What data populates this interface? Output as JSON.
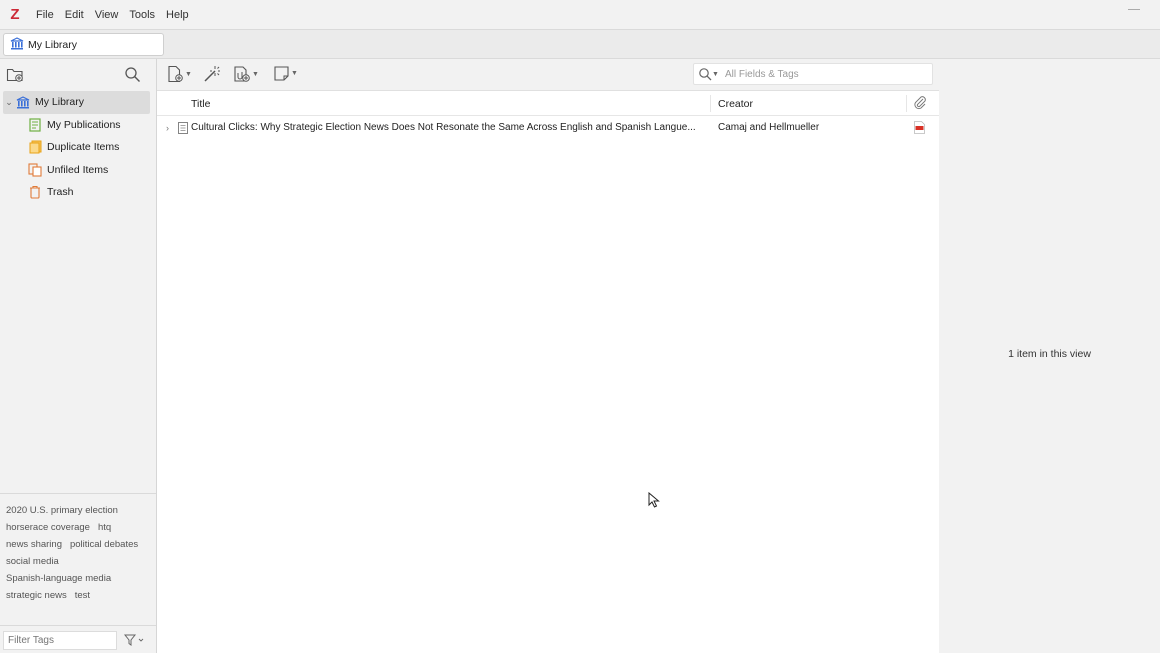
{
  "menubar": {
    "logo": "Z",
    "items": [
      "File",
      "Edit",
      "View",
      "Tools",
      "Help"
    ]
  },
  "tabs": [
    {
      "label": "My Library"
    }
  ],
  "collections": {
    "root": {
      "label": "My Library",
      "icon": "library-icon",
      "expanded": true
    },
    "children": [
      {
        "label": "My Publications",
        "icon": "publications-icon"
      },
      {
        "label": "Duplicate Items",
        "icon": "duplicate-icon"
      },
      {
        "label": "Unfiled Items",
        "icon": "unfiled-icon"
      },
      {
        "label": "Trash",
        "icon": "trash-icon"
      }
    ]
  },
  "tags": {
    "lines": [
      [
        "2020 U.S. primary election"
      ],
      [
        "horserace coverage",
        "htq"
      ],
      [
        "news sharing",
        "political debates"
      ],
      [
        "social media"
      ],
      [
        "Spanish-language media"
      ],
      [
        "strategic news",
        "test"
      ]
    ],
    "filter_placeholder": "Filter Tags"
  },
  "toolbar": {
    "search_placeholder": "All Fields & Tags"
  },
  "columns": {
    "title": "Title",
    "creator": "Creator"
  },
  "items": [
    {
      "title": "Cultural Clicks: Why Strategic Election News Does Not Resonate the Same Across English  and Spanish Langue...",
      "creator": "Camaj and Hellmueller",
      "attachment": "pdf-icon"
    }
  ],
  "item_pane": {
    "message": "1 item in this view"
  },
  "colors": {
    "brand": "#cc2936",
    "library": "#3a6fd8",
    "publications": "#6fb043",
    "duplicate": "#e8a317",
    "unfiled": "#e07b39",
    "trash": "#e07b39",
    "pdf": "#d93025"
  }
}
